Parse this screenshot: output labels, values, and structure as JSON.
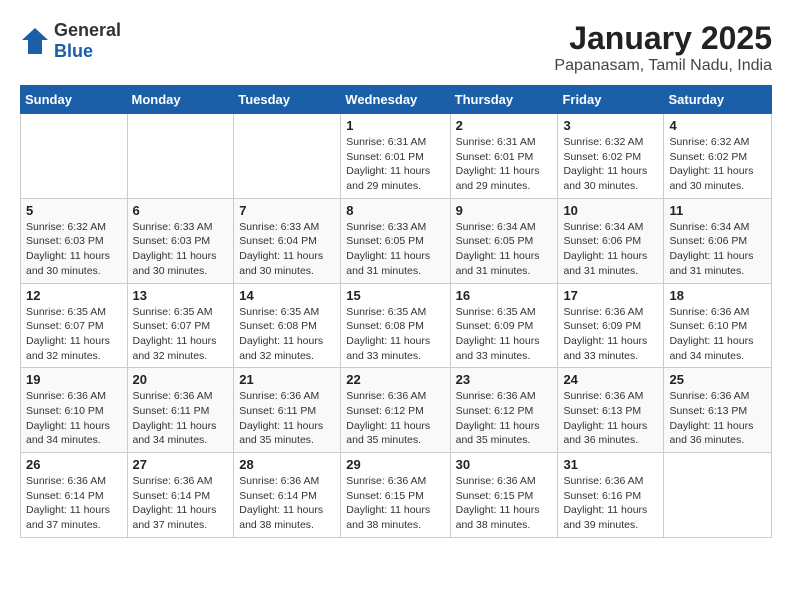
{
  "header": {
    "logo_general": "General",
    "logo_blue": "Blue",
    "month_title": "January 2025",
    "location": "Papanasam, Tamil Nadu, India"
  },
  "weekdays": [
    "Sunday",
    "Monday",
    "Tuesday",
    "Wednesday",
    "Thursday",
    "Friday",
    "Saturday"
  ],
  "weeks": [
    [
      {
        "day": "",
        "info": ""
      },
      {
        "day": "",
        "info": ""
      },
      {
        "day": "",
        "info": ""
      },
      {
        "day": "1",
        "info": "Sunrise: 6:31 AM\nSunset: 6:01 PM\nDaylight: 11 hours and 29 minutes."
      },
      {
        "day": "2",
        "info": "Sunrise: 6:31 AM\nSunset: 6:01 PM\nDaylight: 11 hours and 29 minutes."
      },
      {
        "day": "3",
        "info": "Sunrise: 6:32 AM\nSunset: 6:02 PM\nDaylight: 11 hours and 30 minutes."
      },
      {
        "day": "4",
        "info": "Sunrise: 6:32 AM\nSunset: 6:02 PM\nDaylight: 11 hours and 30 minutes."
      }
    ],
    [
      {
        "day": "5",
        "info": "Sunrise: 6:32 AM\nSunset: 6:03 PM\nDaylight: 11 hours and 30 minutes."
      },
      {
        "day": "6",
        "info": "Sunrise: 6:33 AM\nSunset: 6:03 PM\nDaylight: 11 hours and 30 minutes."
      },
      {
        "day": "7",
        "info": "Sunrise: 6:33 AM\nSunset: 6:04 PM\nDaylight: 11 hours and 30 minutes."
      },
      {
        "day": "8",
        "info": "Sunrise: 6:33 AM\nSunset: 6:05 PM\nDaylight: 11 hours and 31 minutes."
      },
      {
        "day": "9",
        "info": "Sunrise: 6:34 AM\nSunset: 6:05 PM\nDaylight: 11 hours and 31 minutes."
      },
      {
        "day": "10",
        "info": "Sunrise: 6:34 AM\nSunset: 6:06 PM\nDaylight: 11 hours and 31 minutes."
      },
      {
        "day": "11",
        "info": "Sunrise: 6:34 AM\nSunset: 6:06 PM\nDaylight: 11 hours and 31 minutes."
      }
    ],
    [
      {
        "day": "12",
        "info": "Sunrise: 6:35 AM\nSunset: 6:07 PM\nDaylight: 11 hours and 32 minutes."
      },
      {
        "day": "13",
        "info": "Sunrise: 6:35 AM\nSunset: 6:07 PM\nDaylight: 11 hours and 32 minutes."
      },
      {
        "day": "14",
        "info": "Sunrise: 6:35 AM\nSunset: 6:08 PM\nDaylight: 11 hours and 32 minutes."
      },
      {
        "day": "15",
        "info": "Sunrise: 6:35 AM\nSunset: 6:08 PM\nDaylight: 11 hours and 33 minutes."
      },
      {
        "day": "16",
        "info": "Sunrise: 6:35 AM\nSunset: 6:09 PM\nDaylight: 11 hours and 33 minutes."
      },
      {
        "day": "17",
        "info": "Sunrise: 6:36 AM\nSunset: 6:09 PM\nDaylight: 11 hours and 33 minutes."
      },
      {
        "day": "18",
        "info": "Sunrise: 6:36 AM\nSunset: 6:10 PM\nDaylight: 11 hours and 34 minutes."
      }
    ],
    [
      {
        "day": "19",
        "info": "Sunrise: 6:36 AM\nSunset: 6:10 PM\nDaylight: 11 hours and 34 minutes."
      },
      {
        "day": "20",
        "info": "Sunrise: 6:36 AM\nSunset: 6:11 PM\nDaylight: 11 hours and 34 minutes."
      },
      {
        "day": "21",
        "info": "Sunrise: 6:36 AM\nSunset: 6:11 PM\nDaylight: 11 hours and 35 minutes."
      },
      {
        "day": "22",
        "info": "Sunrise: 6:36 AM\nSunset: 6:12 PM\nDaylight: 11 hours and 35 minutes."
      },
      {
        "day": "23",
        "info": "Sunrise: 6:36 AM\nSunset: 6:12 PM\nDaylight: 11 hours and 35 minutes."
      },
      {
        "day": "24",
        "info": "Sunrise: 6:36 AM\nSunset: 6:13 PM\nDaylight: 11 hours and 36 minutes."
      },
      {
        "day": "25",
        "info": "Sunrise: 6:36 AM\nSunset: 6:13 PM\nDaylight: 11 hours and 36 minutes."
      }
    ],
    [
      {
        "day": "26",
        "info": "Sunrise: 6:36 AM\nSunset: 6:14 PM\nDaylight: 11 hours and 37 minutes."
      },
      {
        "day": "27",
        "info": "Sunrise: 6:36 AM\nSunset: 6:14 PM\nDaylight: 11 hours and 37 minutes."
      },
      {
        "day": "28",
        "info": "Sunrise: 6:36 AM\nSunset: 6:14 PM\nDaylight: 11 hours and 38 minutes."
      },
      {
        "day": "29",
        "info": "Sunrise: 6:36 AM\nSunset: 6:15 PM\nDaylight: 11 hours and 38 minutes."
      },
      {
        "day": "30",
        "info": "Sunrise: 6:36 AM\nSunset: 6:15 PM\nDaylight: 11 hours and 38 minutes."
      },
      {
        "day": "31",
        "info": "Sunrise: 6:36 AM\nSunset: 6:16 PM\nDaylight: 11 hours and 39 minutes."
      },
      {
        "day": "",
        "info": ""
      }
    ]
  ]
}
